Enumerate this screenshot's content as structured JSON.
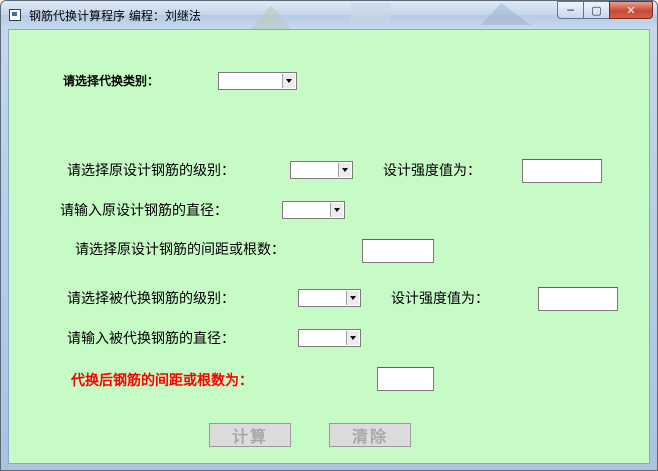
{
  "window": {
    "title": "钢筋代换计算程序 编程：刘继法"
  },
  "titlebar": {
    "min_glyph": "─",
    "max_glyph": "▢",
    "close_glyph": "✕"
  },
  "form": {
    "category_label": "请选择代换类别：",
    "orig_grade_label": "请选择原设计钢筋的级别：",
    "orig_strength_label": "设计强度值为：",
    "orig_diameter_label": "请输入原设计钢筋的直径：",
    "orig_spacing_label": "请选择原设计钢筋的间距或根数：",
    "sub_grade_label": "请选择被代换钢筋的级别：",
    "sub_strength_label": "设计强度值为：",
    "sub_diameter_label": "请输入被代换钢筋的直径：",
    "result_label": "代换后钢筋的间距或根数为："
  },
  "buttons": {
    "calculate": "计算",
    "clear": "清除"
  },
  "colors": {
    "client_bg": "#c6fbc6",
    "result_label": "#ff0000"
  }
}
